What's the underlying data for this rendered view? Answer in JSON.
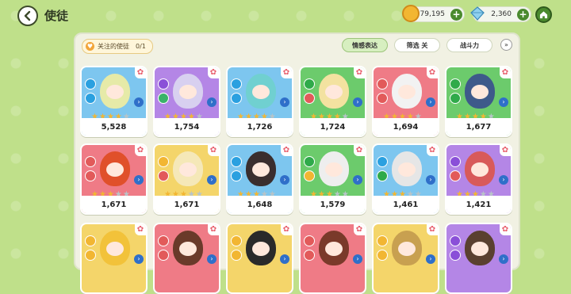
{
  "header": {
    "title": "使徒"
  },
  "resources": [
    {
      "name": "coin",
      "value": "79,195",
      "color": "#f2b632"
    },
    {
      "name": "crystal",
      "value": "2,360",
      "color": "#8fd0ef"
    }
  ],
  "filters": {
    "followed_label": "关注的使徒",
    "followed_count": "0/1",
    "emotion": "情感表达",
    "screen": "筛选 关",
    "power": "战斗力"
  },
  "cards": [
    {
      "power": "5,528",
      "bg": "#7dc6ef",
      "hair": "#e6eaa8",
      "elem": "#2aa0e0",
      "cls": "#2aa0e0",
      "stars": 4
    },
    {
      "power": "1,754",
      "bg": "#b486e6",
      "hair": "#d8d0f0",
      "elem": "#8a4fd8",
      "cls": "#3ab36a",
      "stars": 4
    },
    {
      "power": "1,726",
      "bg": "#7dc6ef",
      "hair": "#70d0d0",
      "elem": "#2aa0e0",
      "cls": "#2aa0e0",
      "stars": 4
    },
    {
      "power": "1,724",
      "bg": "#6ccb6c",
      "hair": "#f3e2a0",
      "elem": "#2faa4a",
      "cls": "#e25a5a",
      "stars": 4
    },
    {
      "power": "1,694",
      "bg": "#ef7b86",
      "hair": "#f2f2f2",
      "elem": "#e25a5a",
      "cls": "#e25a5a",
      "stars": 4
    },
    {
      "power": "1,677",
      "bg": "#6ccb6c",
      "hair": "#3e5a8a",
      "elem": "#2faa4a",
      "cls": "#2faa4a",
      "stars": 4
    },
    {
      "power": "1,671",
      "bg": "#ef7b86",
      "hair": "#e0502a",
      "elem": "#e25a5a",
      "cls": "#e25a5a",
      "stars": 3
    },
    {
      "power": "1,671",
      "bg": "#f4d56a",
      "hair": "#f5e8b8",
      "elem": "#f2b632",
      "cls": "#e25a5a",
      "stars": 3
    },
    {
      "power": "1,648",
      "bg": "#7dc6ef",
      "hair": "#3a2e2e",
      "elem": "#2aa0e0",
      "cls": "#2aa0e0",
      "stars": 3
    },
    {
      "power": "1,579",
      "bg": "#6ccb6c",
      "hair": "#eeeeee",
      "elem": "#2faa4a",
      "cls": "#f2b632",
      "stars": 3
    },
    {
      "power": "1,461",
      "bg": "#7dc6ef",
      "hair": "#e6e6e6",
      "elem": "#2aa0e0",
      "cls": "#2faa4a",
      "stars": 3
    },
    {
      "power": "1,421",
      "bg": "#b486e6",
      "hair": "#d85a5a",
      "elem": "#8a4fd8",
      "cls": "#e25a5a",
      "stars": 3
    },
    {
      "power": "",
      "bg": "#f4d56a",
      "hair": "#f2c23a",
      "elem": "#f2b632",
      "cls": "#f2b632",
      "stars": 0
    },
    {
      "power": "",
      "bg": "#ef7b86",
      "hair": "#6a3a2a",
      "elem": "#e25a5a",
      "cls": "#e25a5a",
      "stars": 0
    },
    {
      "power": "",
      "bg": "#f4d56a",
      "hair": "#2a2a2a",
      "elem": "#f2b632",
      "cls": "#f2b632",
      "stars": 0
    },
    {
      "power": "",
      "bg": "#ef7b86",
      "hair": "#7a3a2a",
      "elem": "#e25a5a",
      "cls": "#e25a5a",
      "stars": 0
    },
    {
      "power": "",
      "bg": "#f4d56a",
      "hair": "#c8a050",
      "elem": "#f2b632",
      "cls": "#f2b632",
      "stars": 0
    },
    {
      "power": "",
      "bg": "#b486e6",
      "hair": "#5a4030",
      "elem": "#8a4fd8",
      "cls": "#8a4fd8",
      "stars": 0
    }
  ]
}
